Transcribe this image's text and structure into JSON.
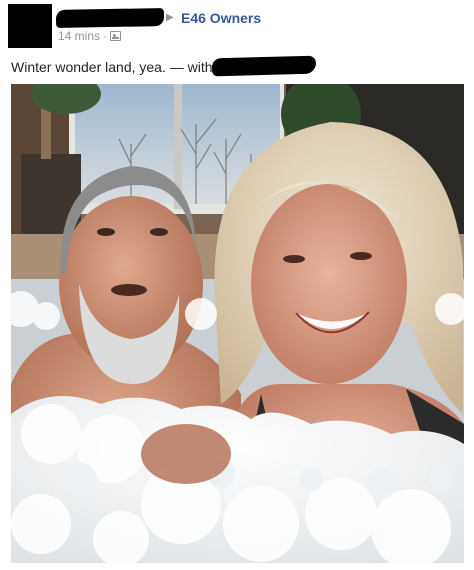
{
  "post": {
    "group_name": "E46 Owners",
    "timestamp": "14 mins",
    "separator": "·",
    "privacy_icon": "friends-icon",
    "caption_text": "Winter wonder land, yea. — with"
  },
  "colors": {
    "link_blue": "#365899",
    "meta_gray": "#90949c",
    "text": "#1d2129",
    "redaction": "#000000"
  },
  "photo": {
    "subject": "selfie-in-hot-tub"
  }
}
